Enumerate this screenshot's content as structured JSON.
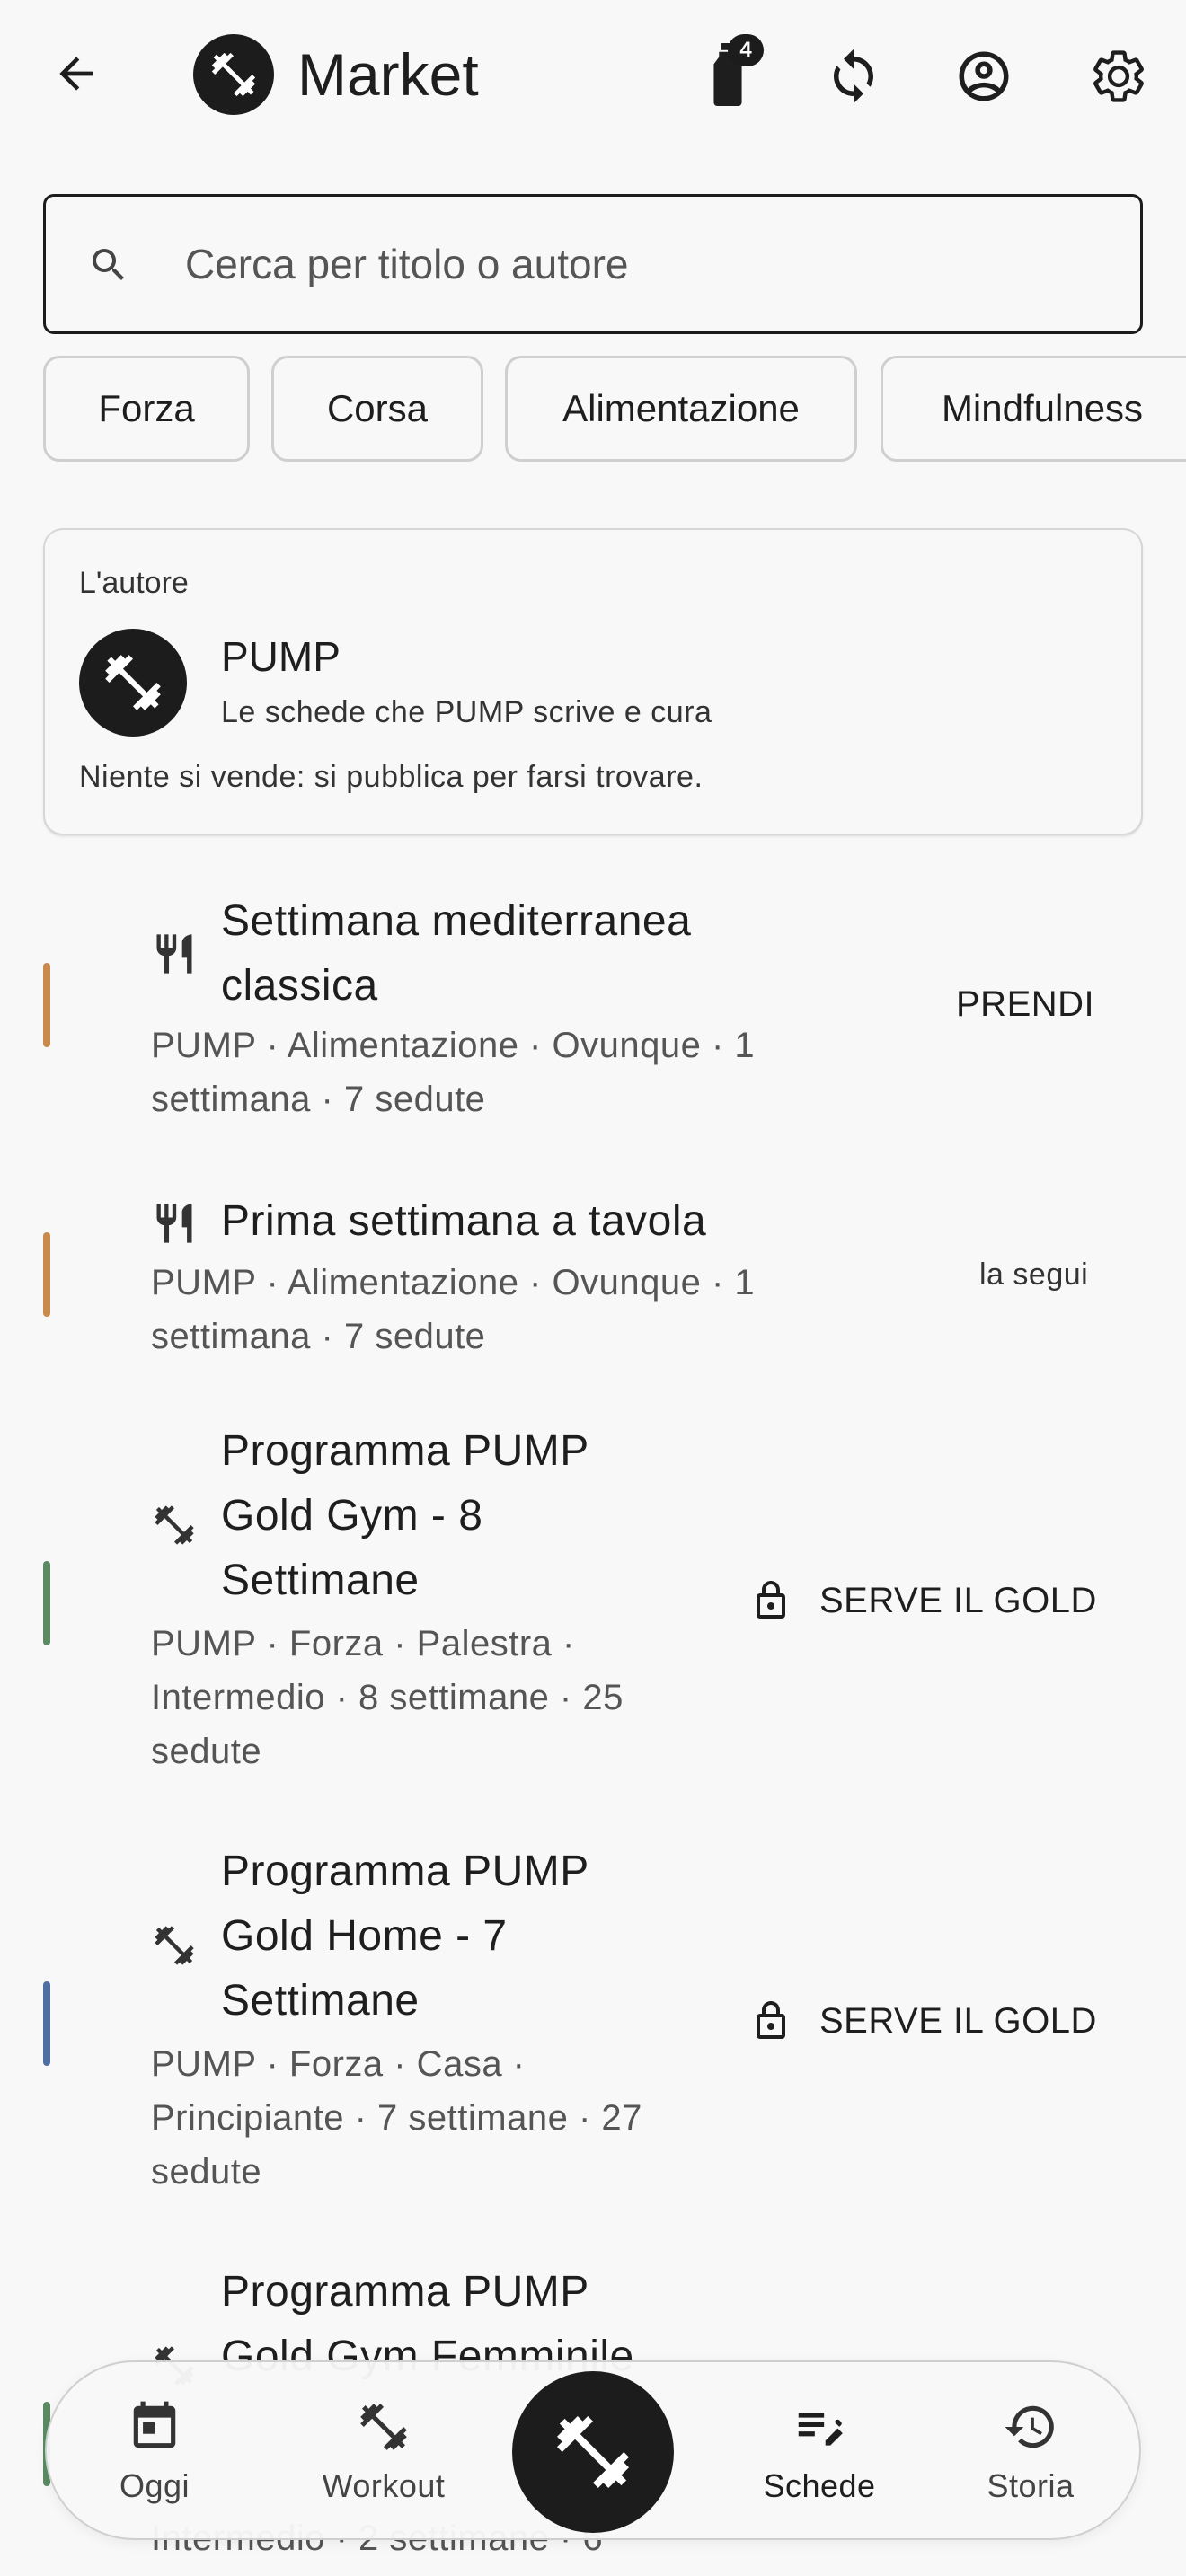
{
  "topbar": {
    "title": "Market",
    "bottle_badge": "4",
    "icons": {
      "back": "arrow-back-icon",
      "brand": "dumbbell-icon",
      "bottle": "water-bottle-icon",
      "sync": "sync-icon",
      "account": "account-circle-icon",
      "settings": "gear-icon"
    }
  },
  "search": {
    "placeholder": "Cerca per titolo o autore",
    "value": ""
  },
  "chips": [
    "Forza",
    "Corsa",
    "Alimentazione",
    "Mindfulness"
  ],
  "author": {
    "kicker": "L'autore",
    "name": "PUMP",
    "subtitle": "Le schede che PUMP scrive e cura",
    "note": "Niente si vende: si pubblica per farsi trovare."
  },
  "programs": [
    {
      "title_lines": [
        "Settimana mediterranea",
        "classica"
      ],
      "meta_lines": [
        "PUMP · Alimentazione · Ovunque · 1",
        "settimana · 7 sedute"
      ],
      "action": "PRENDI",
      "icon": "fork-knife-icon",
      "accent": "#c98a4b"
    },
    {
      "title_lines": [
        "Prima settimana a tavola"
      ],
      "meta_lines": [
        "PUMP · Alimentazione · Ovunque · 1",
        "settimana · 7 sedute"
      ],
      "action": "la segui",
      "icon": "fork-knife-icon",
      "accent": "#c98a4b"
    },
    {
      "title_lines": [
        "Programma PUMP",
        "Gold Gym - 8",
        "Settimane"
      ],
      "meta_lines": [
        "PUMP · Forza · Palestra ·",
        "Intermedio · 8 settimane · 25",
        "sedute"
      ],
      "action": "SERVE IL GOLD",
      "icon": "dumbbell-icon",
      "accent": "#5b8a63"
    },
    {
      "title_lines": [
        "Programma PUMP",
        "Gold Home - 7",
        "Settimane"
      ],
      "meta_lines": [
        "PUMP · Forza · Casa ·",
        "Principiante · 7 settimane · 27",
        "sedute"
      ],
      "action": "SERVE IL GOLD",
      "icon": "dumbbell-icon",
      "accent": "#4f6fa3"
    },
    {
      "title_lines": [
        "Programma PUMP",
        "Gold Gym Femminile"
      ],
      "meta_lines": [
        "Intermedio · 2 settimane · 6"
      ],
      "icon": "dumbbell-icon",
      "accent": "#5b8a63"
    }
  ],
  "nav": {
    "items": [
      {
        "label": "Oggi",
        "icon": "calendar-icon"
      },
      {
        "label": "Workout",
        "icon": "dumbbell-icon"
      },
      {
        "label": "Schede",
        "icon": "edit-list-icon"
      },
      {
        "label": "Storia",
        "icon": "history-icon"
      }
    ],
    "center_icon": "dumbbell-icon",
    "active": "Schede"
  }
}
